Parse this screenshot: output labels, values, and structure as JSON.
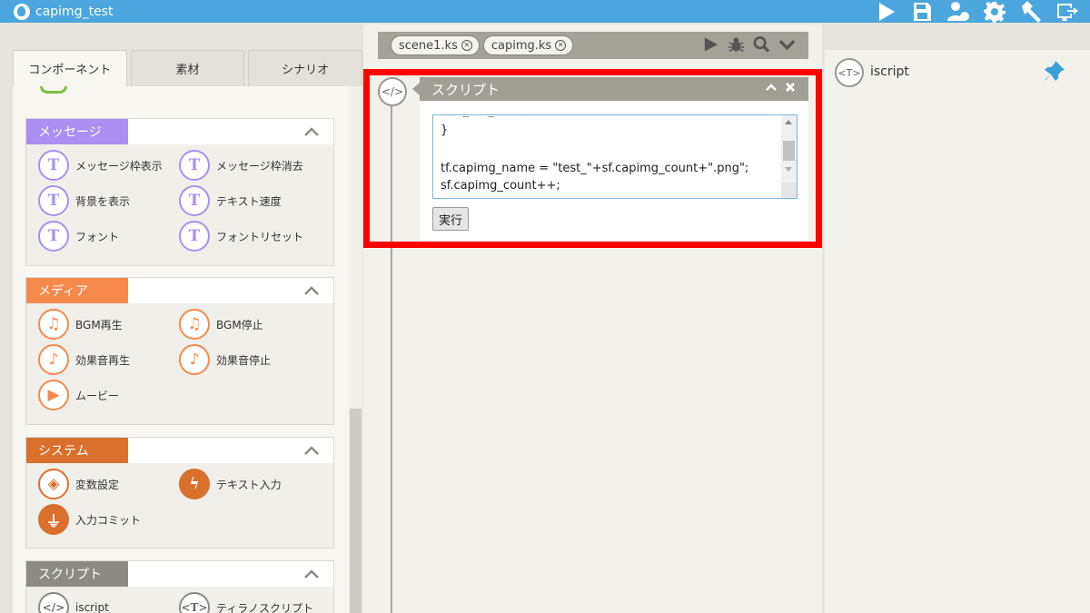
{
  "app": {
    "title": "capimg_test"
  },
  "left_tabs": [
    "コンポーネント",
    "素材",
    "シナリオ"
  ],
  "sections": {
    "message": {
      "label": "メッセージ",
      "color": "#a98ff0",
      "items": [
        "メッセージ枠表示",
        "メッセージ枠消去",
        "背景を表示",
        "テキスト速度",
        "フォント",
        "フォントリセット"
      ]
    },
    "media": {
      "label": "メディア",
      "color": "#f58a4b",
      "items": [
        "BGM再生",
        "BGM停止",
        "効果音再生",
        "効果音停止",
        "ムービー"
      ]
    },
    "system": {
      "label": "システム",
      "color": "#d9702c",
      "items": [
        "変数設定",
        "テキスト入力",
        "入力コミット"
      ]
    },
    "script": {
      "label": "スクリプト",
      "color": "#8c8a84",
      "items": [
        "iscript",
        "ティラノスクリプト"
      ]
    }
  },
  "file_tabs": [
    "scene1.ks",
    "capimg.ks"
  ],
  "script_panel": {
    "title": "スクリプト",
    "code_lines": [
      "}",
      "",
      "tf.capimg_name = \"test_\"+sf.capimg_count+\".png\";",
      "sf.capimg_count++;"
    ],
    "run_label": "実行"
  },
  "right_panel": {
    "label": "iscript"
  }
}
